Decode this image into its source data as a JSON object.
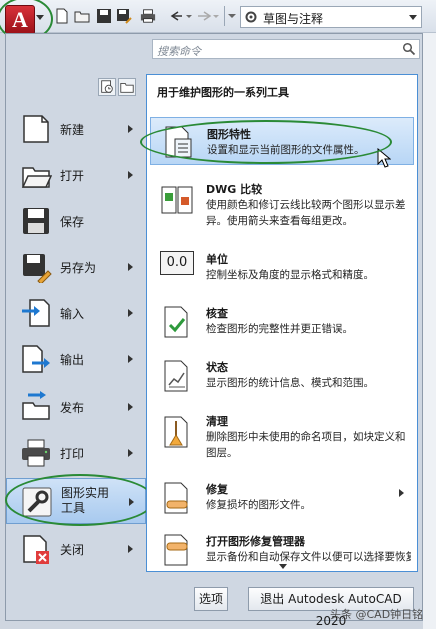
{
  "toolbar": {
    "workspace_label": "草图与注释"
  },
  "search": {
    "placeholder": "搜索命令"
  },
  "left_menu": [
    {
      "label": "新建",
      "has_submenu": true,
      "icon": "new-document-icon"
    },
    {
      "label": "打开",
      "has_submenu": true,
      "icon": "open-folder-icon"
    },
    {
      "label": "保存",
      "has_submenu": false,
      "icon": "save-floppy-icon"
    },
    {
      "label": "另存为",
      "has_submenu": true,
      "icon": "save-as-icon"
    },
    {
      "label": "输入",
      "has_submenu": true,
      "icon": "import-icon"
    },
    {
      "label": "输出",
      "has_submenu": true,
      "icon": "export-icon"
    },
    {
      "label": "发布",
      "has_submenu": true,
      "icon": "publish-icon"
    },
    {
      "label": "打印",
      "has_submenu": true,
      "icon": "print-icon"
    },
    {
      "label_line1": "图形实用",
      "label_line2": "工具",
      "has_submenu": true,
      "active": true,
      "icon": "drawing-utilities-icon"
    },
    {
      "label": "关闭",
      "has_submenu": true,
      "icon": "close-document-icon"
    }
  ],
  "flyout": {
    "header": "用于维护图形的一系列工具",
    "items": [
      {
        "title": "图形特性",
        "desc": "设置和显示当前图形的文件属性。",
        "highlighted": true,
        "icon": "drawing-properties-icon"
      },
      {
        "title": "DWG 比较",
        "desc": "使用颜色和修订云线比较两个图形以显示差异。使用箭头来查看每组更改。",
        "icon": "dwg-compare-icon"
      },
      {
        "title": "单位",
        "desc": "控制坐标及角度的显示格式和精度。",
        "icon": "units-icon",
        "icon_text": "0.0"
      },
      {
        "title": "核查",
        "desc": "检查图形的完整性并更正错误。",
        "icon": "audit-icon"
      },
      {
        "title": "状态",
        "desc": "显示图形的统计信息、模式和范围。",
        "icon": "status-icon"
      },
      {
        "title": "清理",
        "desc": "删除图形中未使用的命名项目，如块定义和图层。",
        "icon": "purge-icon"
      },
      {
        "title": "修复",
        "desc": "修复损坏的图形文件。",
        "has_submenu": true,
        "icon": "recover-icon"
      },
      {
        "title": "打开图形修复管理器",
        "desc": "显示备份和自动保存文件以便可以选择要恢复",
        "icon": "recovery-manager-icon"
      }
    ]
  },
  "buttons": {
    "options": "选项",
    "exit": "退出 Autodesk AutoCAD 2020"
  },
  "watermark": "头条 @CAD钟日铭"
}
